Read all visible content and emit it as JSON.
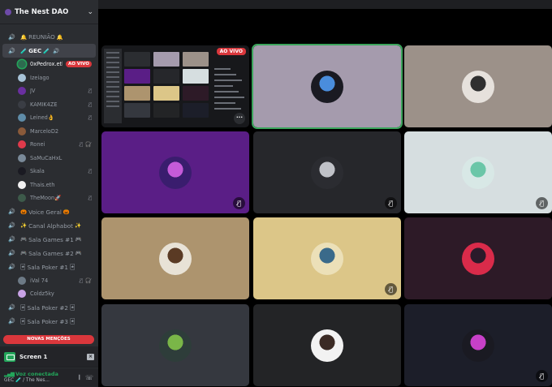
{
  "server": {
    "name": "The Nest DAO"
  },
  "channels": [
    {
      "name": "REUNIÃO",
      "emoji_before": "🔔",
      "emoji_after": "🔔"
    },
    {
      "name": "GEC",
      "emoji_before": "🧪",
      "emoji_after": "🧪",
      "active": true
    }
  ],
  "gec_users": [
    {
      "name": "0xPedrox.eth",
      "live": "AO VIVO",
      "speaking": true,
      "color": "#2d6b4f"
    },
    {
      "name": "Izeiago",
      "color": "#a8c3d8"
    },
    {
      "name": "JV",
      "color": "#6a2fa0",
      "mute": "🎙̸"
    },
    {
      "name": "KAMIK4ZE",
      "color": "#3a3d44",
      "mute": "🎙̸"
    },
    {
      "name": "Leined",
      "emoji": "👌",
      "color": "#5f8ca8",
      "mute": "🎙̸"
    },
    {
      "name": "MarceloD2",
      "color": "#8a5a3a"
    },
    {
      "name": "Ronei",
      "color": "#e03a4b",
      "mute": "🎙̸",
      "deafen": "🎧̸"
    },
    {
      "name": "SaMuCaHxL",
      "color": "#7a8a99"
    },
    {
      "name": "Skala",
      "color": "#1a1a22",
      "mute": "🎙̸"
    },
    {
      "name": "Thais.eth",
      "color": "#f1f1f1"
    },
    {
      "name": "TheMoon",
      "emoji": "🚀",
      "color": "#3d5a4a",
      "mute": "🎙̸"
    }
  ],
  "channels_after": [
    {
      "name": "Voice Geral",
      "emoji_before": "🎃",
      "emoji_after": "🎃"
    },
    {
      "name": "Canal Alphabot",
      "emoji_before": "✨",
      "emoji_after": "✨"
    },
    {
      "name": "Sala Games #1",
      "emoji_before": "🎮",
      "emoji_after": "🎮"
    },
    {
      "name": "Sala Games #2",
      "emoji_before": "🎮",
      "emoji_after": "🎮"
    },
    {
      "name": "Sala Poker #1",
      "emoji_before": "🃏",
      "emoji_after": "🃏"
    }
  ],
  "poker_users": [
    {
      "name": "iVal 74",
      "color": "#6d7a86",
      "mute": "🎙̸",
      "deafen": "🎧̸"
    },
    {
      "name": "Coldz5ky",
      "color": "#c9a3e6"
    }
  ],
  "channels_tail": [
    {
      "name": "Sala Poker #2",
      "emoji_before": "🃏",
      "emoji_after": "🃏"
    },
    {
      "name": "Sala Poker #3",
      "emoji_before": "🃏",
      "emoji_after": "🃏"
    }
  ],
  "mentions_label": "NOVAS MENÇÕES",
  "screen_label": "Screen 1",
  "voice": {
    "status": "Voz conectada",
    "channel": "GEC 🧪 / The Nes..."
  },
  "share_badge": "AO VIVO",
  "tiles": [
    {
      "type": "share"
    },
    {
      "bg": "#a59bad",
      "avatar": "#1a1a22",
      "accent": "#4a8ddc",
      "selected": true
    },
    {
      "bg": "#9c9189",
      "avatar": "#e6e1dc",
      "accent": "#2f2f2f"
    },
    {
      "bg": "#5a1e86",
      "avatar": "#3a1d6e",
      "accent": "#c55bd8",
      "mute": true
    },
    {
      "bg": "#26272b",
      "avatar": "#2b2c31",
      "accent": "#c0c2c8",
      "mute": true
    },
    {
      "bg": "#d6dee0",
      "avatar": "#d8e8e6",
      "accent": "#6bc6a8",
      "mute": true
    },
    {
      "bg": "#ad946e",
      "avatar": "#e8e2d6",
      "accent": "#5a3a24"
    },
    {
      "bg": "#dcc688",
      "avatar": "#ece0b8",
      "accent": "#3a6a8a",
      "mute": true
    },
    {
      "bg": "#2d1a27",
      "avatar": "#d92b4a",
      "accent": "#2a1a2a"
    },
    {
      "bg": "#35383f",
      "avatar": "#2e3d3a",
      "accent": "#7ab648"
    },
    {
      "bg": "#232426",
      "avatar": "#f2f2f2",
      "accent": "#3b2a24"
    },
    {
      "bg": "#1c1e29",
      "avatar": "#1a1a22",
      "accent": "#c840c8",
      "mute": true
    }
  ]
}
